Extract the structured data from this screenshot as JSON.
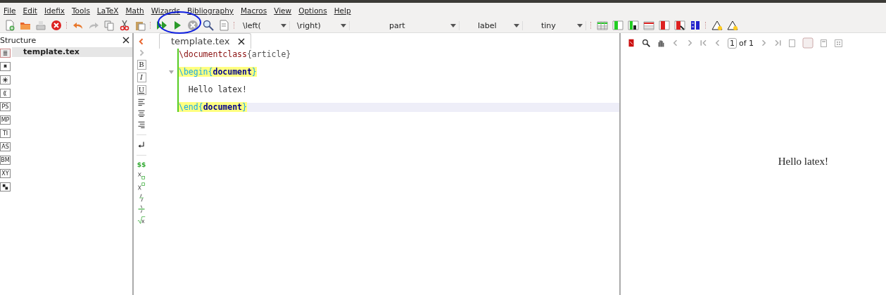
{
  "menu": [
    "File",
    "Edit",
    "Idefix",
    "Tools",
    "LaTeX",
    "Math",
    "Wizards",
    "Bibliography",
    "Macros",
    "View",
    "Options",
    "Help"
  ],
  "toolbar": {
    "combos": [
      "\\left(",
      "\\right)",
      "part",
      "label",
      "tiny"
    ]
  },
  "structure": {
    "title": "Structure",
    "items": [
      {
        "label": "template.tex",
        "selected": true
      }
    ],
    "side_icons": [
      {
        "kind": "glyph",
        "selected": true
      },
      {
        "kind": "glyph",
        "selected": false
      },
      {
        "kind": "glyph",
        "selected": false
      },
      {
        "kind": "glyph",
        "selected": false
      },
      {
        "kind": "text",
        "label": "PS",
        "selected": false
      },
      {
        "kind": "text",
        "label": "MP",
        "selected": false
      },
      {
        "kind": "text",
        "label": "TI",
        "selected": false
      },
      {
        "kind": "text",
        "label": "AS",
        "selected": false
      },
      {
        "kind": "text",
        "label": "BM",
        "selected": false
      },
      {
        "kind": "text",
        "label": "XY",
        "selected": false
      },
      {
        "kind": "glyph",
        "selected": false
      }
    ]
  },
  "format_bar": [
    {
      "kind": "collapse"
    },
    {
      "kind": "expand"
    },
    {
      "kind": "bold",
      "label": "B"
    },
    {
      "kind": "italic",
      "label": "I"
    },
    {
      "kind": "underline",
      "label": "U"
    },
    {
      "kind": "align-left"
    },
    {
      "kind": "align-center"
    },
    {
      "kind": "align-right"
    },
    {
      "kind": "separator"
    },
    {
      "kind": "newline"
    },
    {
      "kind": "separator"
    },
    {
      "kind": "math",
      "label": "$$"
    },
    {
      "kind": "subscript"
    },
    {
      "kind": "superscript"
    },
    {
      "kind": "frac"
    },
    {
      "kind": "dfrac"
    },
    {
      "kind": "sqrt"
    }
  ],
  "editor": {
    "tabs": [
      {
        "label": "template.tex",
        "selected": true
      }
    ],
    "lines": [
      {
        "foldable": false,
        "current": false,
        "tokens": [
          {
            "kind": "command",
            "text": "\\documentclass",
            "match": false
          },
          {
            "kind": "brace",
            "text": "{article}",
            "match": false
          }
        ]
      },
      {
        "foldable": false,
        "current": false
      },
      {
        "foldable": true,
        "current": false,
        "tokens": [
          {
            "kind": "env",
            "text": "\\begin{",
            "match": true
          },
          {
            "kind": "arg",
            "text": "document",
            "match": true
          },
          {
            "kind": "env",
            "text": "}",
            "match": true
          }
        ]
      },
      {
        "foldable": false,
        "current": false
      },
      {
        "foldable": false,
        "current": false,
        "tokens": [
          {
            "kind": "text",
            "text": "  Hello latex!",
            "match": false
          }
        ]
      },
      {
        "foldable": false,
        "current": false
      },
      {
        "foldable": false,
        "current": true,
        "tokens": [
          {
            "kind": "env",
            "text": "\\end{",
            "match": true
          },
          {
            "kind": "arg",
            "text": "document",
            "match": true
          },
          {
            "kind": "env",
            "text": "}",
            "match": true
          }
        ]
      }
    ]
  },
  "viewer": {
    "page": "1",
    "page_count": "of 1",
    "content": "Hello latex!"
  }
}
